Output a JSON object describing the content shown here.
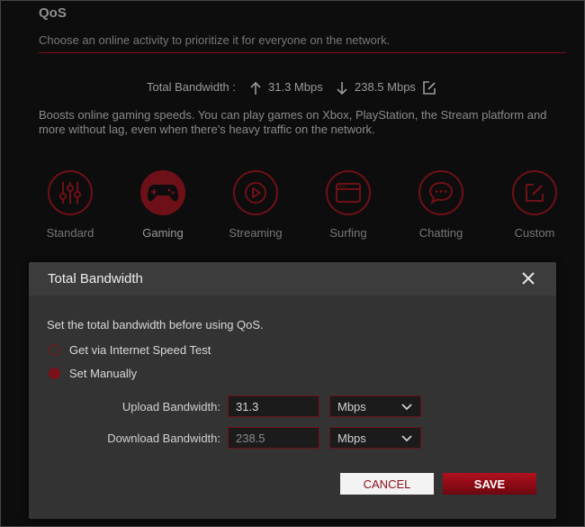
{
  "page": {
    "title": "QoS",
    "subtitle": "Choose an online activity to prioritize it for everyone on the network.",
    "description": "Boosts online gaming speeds. You can play games on Xbox, PlayStation, the Stream platform and more without lag, even when there's heavy traffic on the network."
  },
  "bandwidth": {
    "label": "Total Bandwidth :",
    "upload": "31.3 Mbps",
    "download": "238.5 Mbps"
  },
  "modes": [
    {
      "label": "Standard",
      "icon": "sliders-icon",
      "active": false
    },
    {
      "label": "Gaming",
      "icon": "gamepad-icon",
      "active": true
    },
    {
      "label": "Streaming",
      "icon": "play-icon",
      "active": false
    },
    {
      "label": "Surfing",
      "icon": "browser-icon",
      "active": false
    },
    {
      "label": "Chatting",
      "icon": "chat-icon",
      "active": false
    },
    {
      "label": "Custom",
      "icon": "edit-icon",
      "active": false
    }
  ],
  "modal": {
    "title": "Total Bandwidth",
    "hint": "Set the total bandwidth before using QoS.",
    "option_speed_test": "Get via Internet Speed Test",
    "option_manual": "Set Manually",
    "upload_label": "Upload Bandwidth:",
    "upload_value": "31.3",
    "upload_unit": "Mbps",
    "download_label": "Download Bandwidth:",
    "download_value": "238.5",
    "download_unit": "Mbps",
    "cancel_label": "CANCEL",
    "save_label": "SAVE"
  },
  "colors": {
    "accent": "#6e1017",
    "save_button": "#b1101d"
  }
}
